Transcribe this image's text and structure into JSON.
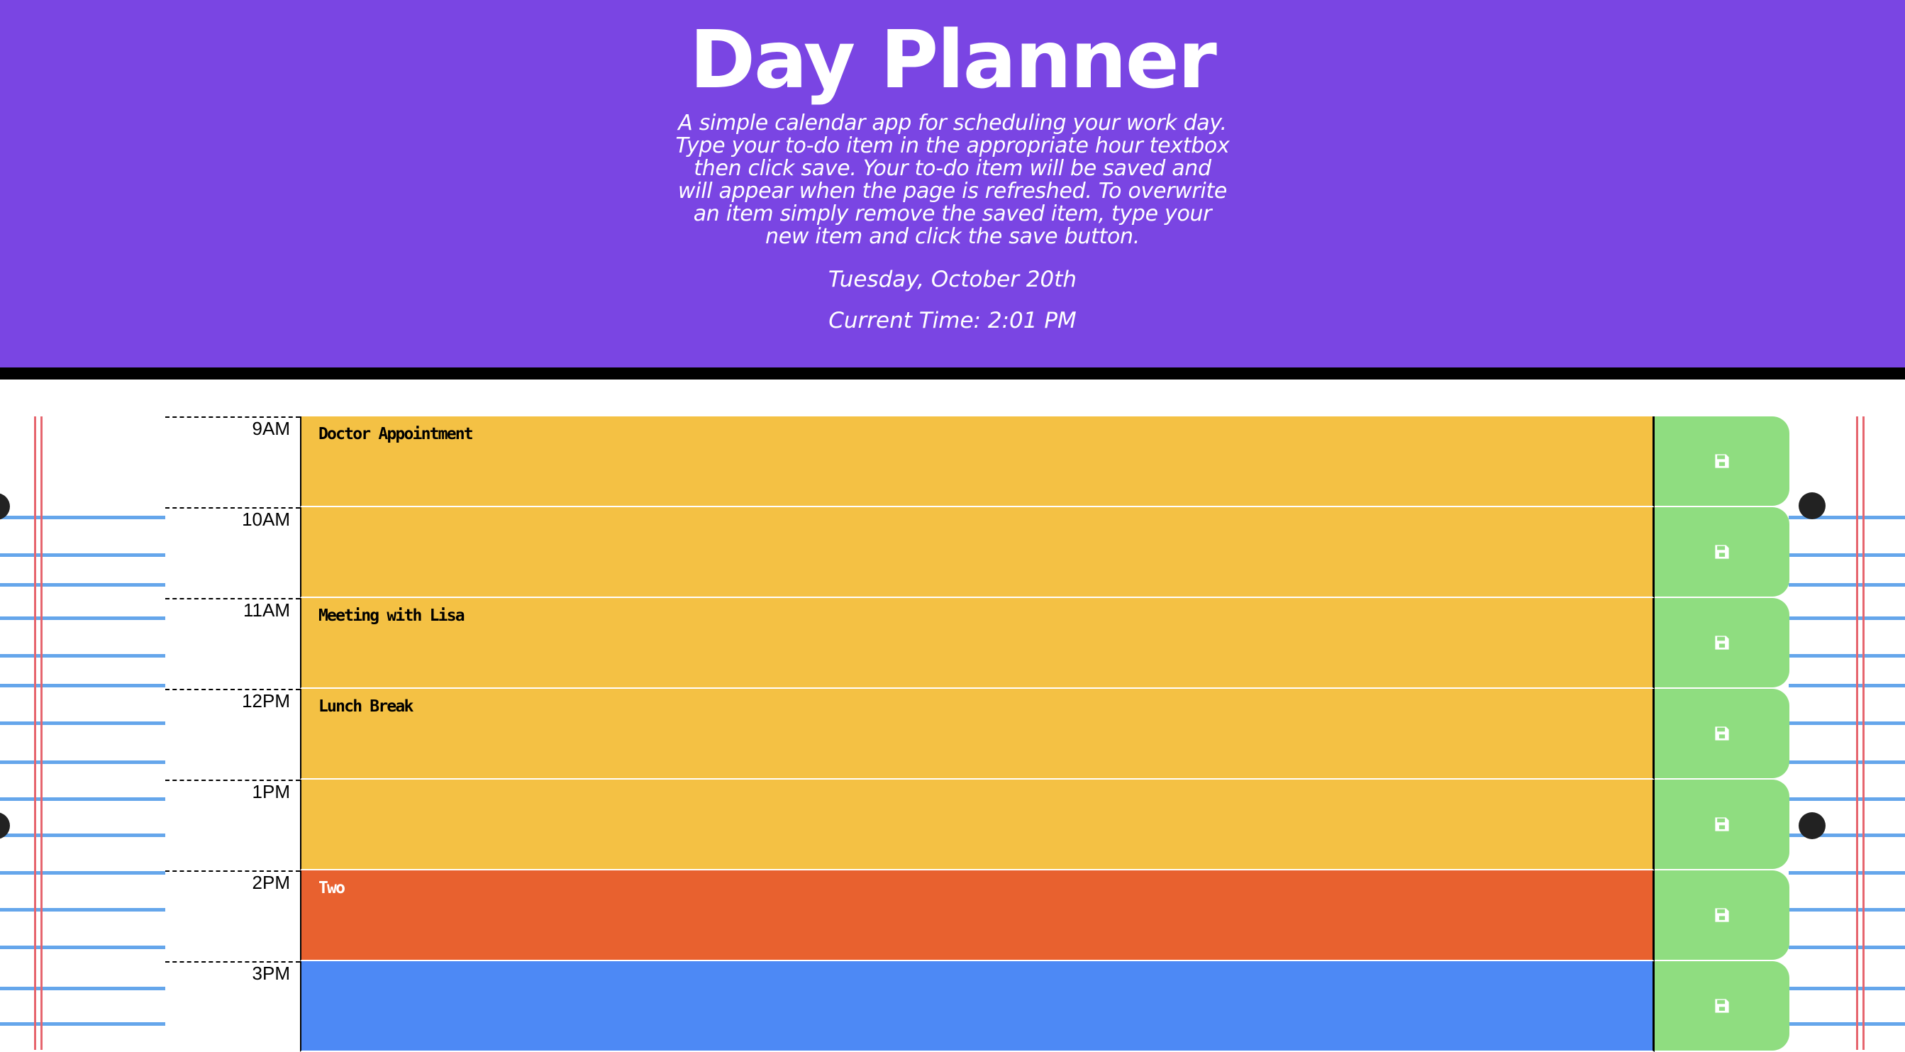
{
  "header": {
    "title": "Day Planner",
    "lead_lines": [
      "A simple calendar app for scheduling your work day.",
      "Type your to-do item in the appropriate hour textbox",
      "then click save. Your to-do item will be saved and",
      "will appear when the page is refreshed. To overwrite",
      "an item simply remove the saved item, type your",
      "new item and click the save button."
    ],
    "current_day": "Tuesday, October 20th",
    "current_time": "Current Time: 2:01 PM"
  },
  "colors": {
    "header_background": "#7a45e3",
    "past": "#f4c144",
    "present": "#e8612f",
    "future": "#4d89f5",
    "save_button": "#8fdd80",
    "rule_line": "#65a6eb",
    "margin_line": "#e6656e"
  },
  "time_blocks": [
    {
      "hour": "9AM",
      "text": "Doctor Appointment",
      "status": "past",
      "save_icon": "floppy-disk-icon"
    },
    {
      "hour": "10AM",
      "text": "",
      "status": "past",
      "save_icon": "floppy-disk-icon"
    },
    {
      "hour": "11AM",
      "text": "Meeting with Lisa",
      "status": "past",
      "save_icon": "floppy-disk-icon"
    },
    {
      "hour": "12PM",
      "text": "Lunch Break",
      "status": "past",
      "save_icon": "floppy-disk-icon"
    },
    {
      "hour": "1PM",
      "text": "",
      "status": "past",
      "save_icon": "floppy-disk-icon"
    },
    {
      "hour": "2PM",
      "text": "Two",
      "status": "present",
      "save_icon": "floppy-disk-icon"
    },
    {
      "hour": "3PM",
      "text": "",
      "status": "future",
      "save_icon": "floppy-disk-icon"
    }
  ]
}
